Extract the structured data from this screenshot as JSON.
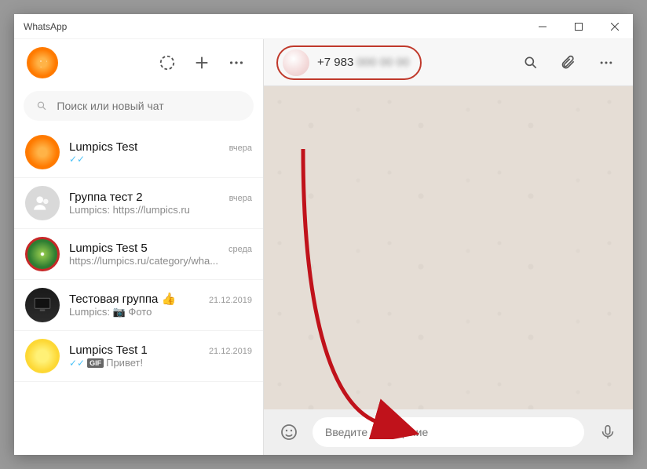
{
  "window": {
    "title": "WhatsApp"
  },
  "sidebar": {
    "search_placeholder": "Поиск или новый чат",
    "chats": [
      {
        "name": "Lumpics Test",
        "time": "вчера",
        "ticks": true,
        "preview": ""
      },
      {
        "name": "Группа тест 2",
        "time": "вчера",
        "preview": "Lumpics: https://lumpics.ru"
      },
      {
        "name": "Lumpics Test 5",
        "time": "среда",
        "preview": "https://lumpics.ru/category/wha..."
      },
      {
        "name": "Тестовая группа 👍",
        "time": "21.12.2019",
        "preview": "Lumpics: 📷 Фото"
      },
      {
        "name": "Lumpics Test 1",
        "time": "21.12.2019",
        "ticks": true,
        "gif": "GIF",
        "preview": "Привет!"
      }
    ]
  },
  "conversation": {
    "contact_number_visible": "+7 983",
    "contact_number_hidden": "000 00 00"
  },
  "composer": {
    "placeholder": "Введите сообщение"
  },
  "icons": {
    "status": "status-circle-icon",
    "new_chat": "plus-icon",
    "menu": "dots-icon",
    "search": "search-icon",
    "attach": "paperclip-icon",
    "emoji": "smile-icon",
    "mic": "mic-icon"
  }
}
